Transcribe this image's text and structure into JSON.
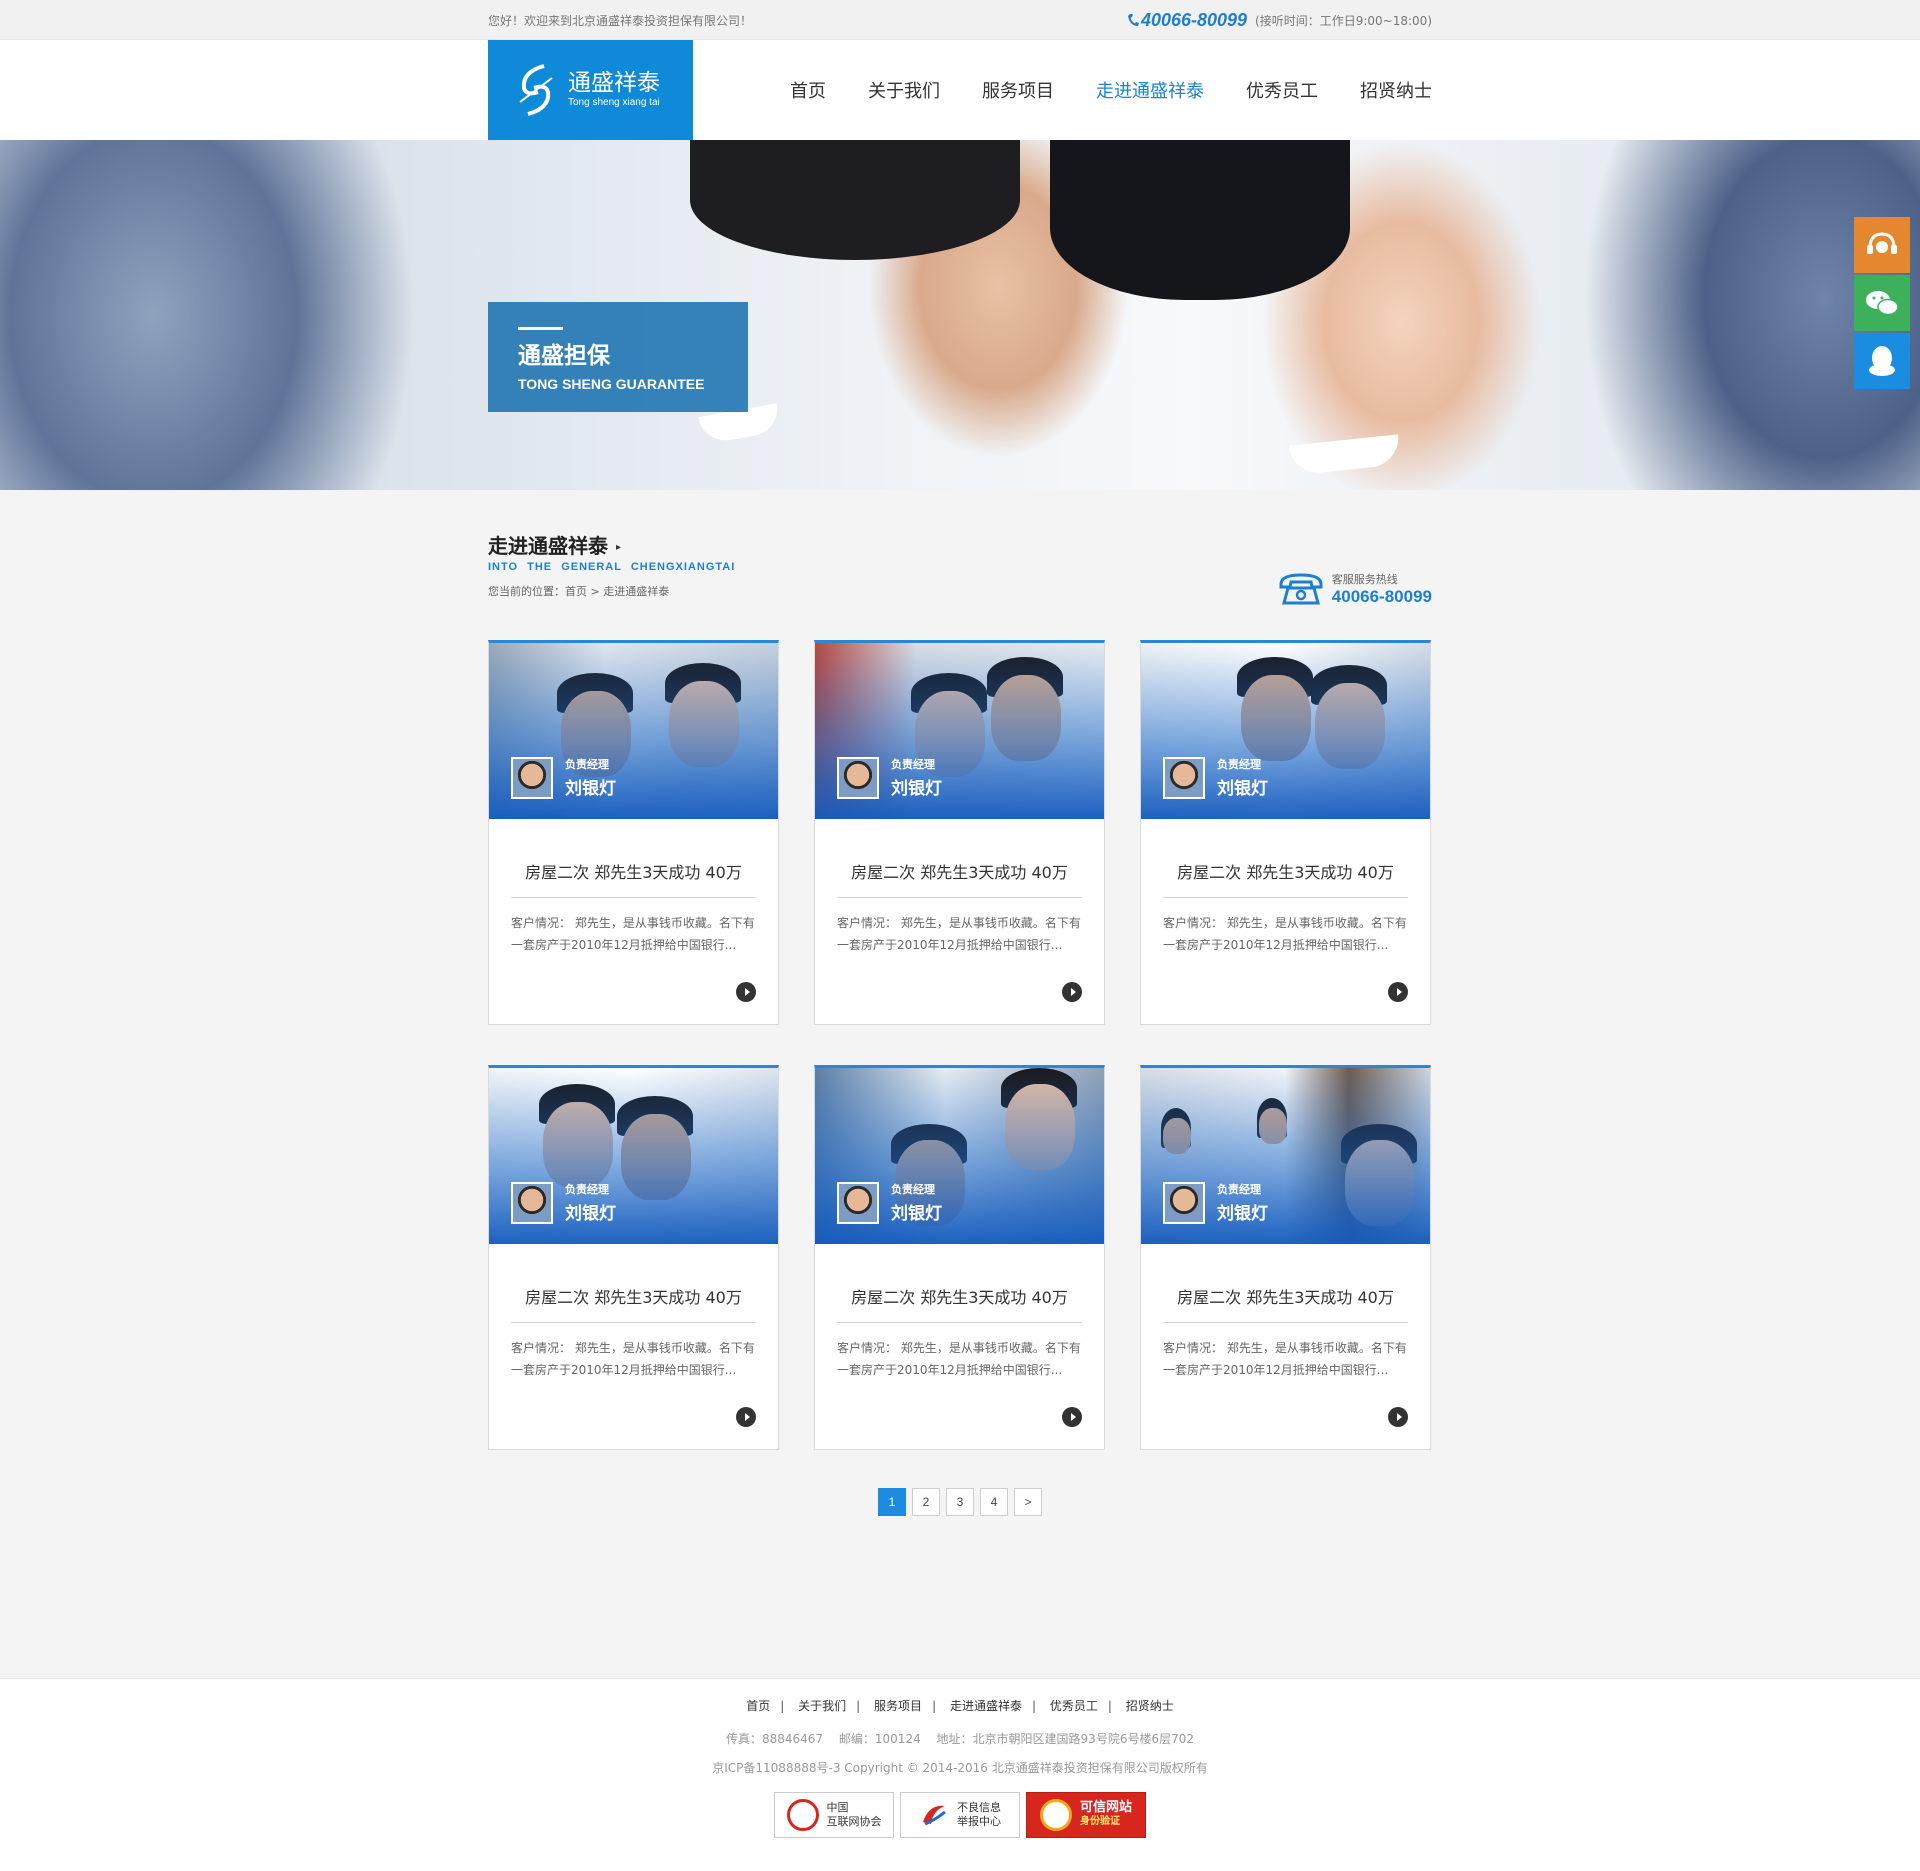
{
  "topbar": {
    "welcome": "您好！欢迎来到北京通盛祥泰投资担保有限公司！",
    "phone": "40066-80099",
    "hours": "(接听时间：工作日9:00~18:00)"
  },
  "logo": {
    "cn": "通盛祥泰",
    "en": "Tong sheng xiang tai"
  },
  "nav": [
    {
      "label": "首页",
      "active": false
    },
    {
      "label": "关于我们",
      "active": false
    },
    {
      "label": "服务项目",
      "active": false
    },
    {
      "label": "走进通盛祥泰",
      "active": true
    },
    {
      "label": "优秀员工",
      "active": false
    },
    {
      "label": "招贤纳士",
      "active": false
    }
  ],
  "banner": {
    "cn": "通盛担保",
    "en": "TONG SHENG GUARANTEE"
  },
  "section": {
    "title_cn": "走进通盛祥泰",
    "title_en": "INTO THE GENERAL CHENGXIANGTAI",
    "breadcrumb": "您当前的位置：首页 > 走进通盛祥泰",
    "service_label": "客服服务热线",
    "service_phone": "40066-80099"
  },
  "cards": [
    {
      "role": "负责经理",
      "name": "刘银灯",
      "title": "房屋二次 郑先生3天成功 40万",
      "desc": "客户情况： 郑先生，是从事钱币收藏。名下有一套房产于2010年12月抵押给中国银行..."
    },
    {
      "role": "负责经理",
      "name": "刘银灯",
      "title": "房屋二次 郑先生3天成功 40万",
      "desc": "客户情况： 郑先生，是从事钱币收藏。名下有一套房产于2010年12月抵押给中国银行..."
    },
    {
      "role": "负责经理",
      "name": "刘银灯",
      "title": "房屋二次 郑先生3天成功 40万",
      "desc": "客户情况： 郑先生，是从事钱币收藏。名下有一套房产于2010年12月抵押给中国银行..."
    },
    {
      "role": "负责经理",
      "name": "刘银灯",
      "title": "房屋二次 郑先生3天成功 40万",
      "desc": "客户情况： 郑先生，是从事钱币收藏。名下有一套房产于2010年12月抵押给中国银行..."
    },
    {
      "role": "负责经理",
      "name": "刘银灯",
      "title": "房屋二次 郑先生3天成功 40万",
      "desc": "客户情况： 郑先生，是从事钱币收藏。名下有一套房产于2010年12月抵押给中国银行..."
    },
    {
      "role": "负责经理",
      "name": "刘银灯",
      "title": "房屋二次 郑先生3天成功 40万",
      "desc": "客户情况： 郑先生，是从事钱币收藏。名下有一套房产于2010年12月抵押给中国银行..."
    }
  ],
  "pager": {
    "pages": [
      "1",
      "2",
      "3",
      "4"
    ],
    "current": "1",
    "next": ">"
  },
  "footer": {
    "nav": [
      "首页",
      "关于我们",
      "服务项目",
      "走进通盛祥泰",
      "优秀员工",
      "招贤纳士"
    ],
    "fax": "传真：88846467",
    "zip": "邮编：100124",
    "address": "地址：北京市朝阳区建国路93号院6号楼6层702",
    "copyright": "京ICP备11088888号-3 Copyright © 2014-2016 北京通盛祥泰投资担保有限公司版权所有",
    "badges": [
      {
        "l1": "中国",
        "l2": "互联网协会"
      },
      {
        "l1": "不良信息",
        "l2": "举报中心"
      },
      {
        "l1": "可信网站",
        "l2": "身份验证"
      }
    ]
  },
  "colors": {
    "brand": "#0f8ad9",
    "nav_active": "#1d83d3",
    "float_service": "#e5872f",
    "float_wechat": "#3db05c",
    "float_qq": "#1a8de0"
  }
}
